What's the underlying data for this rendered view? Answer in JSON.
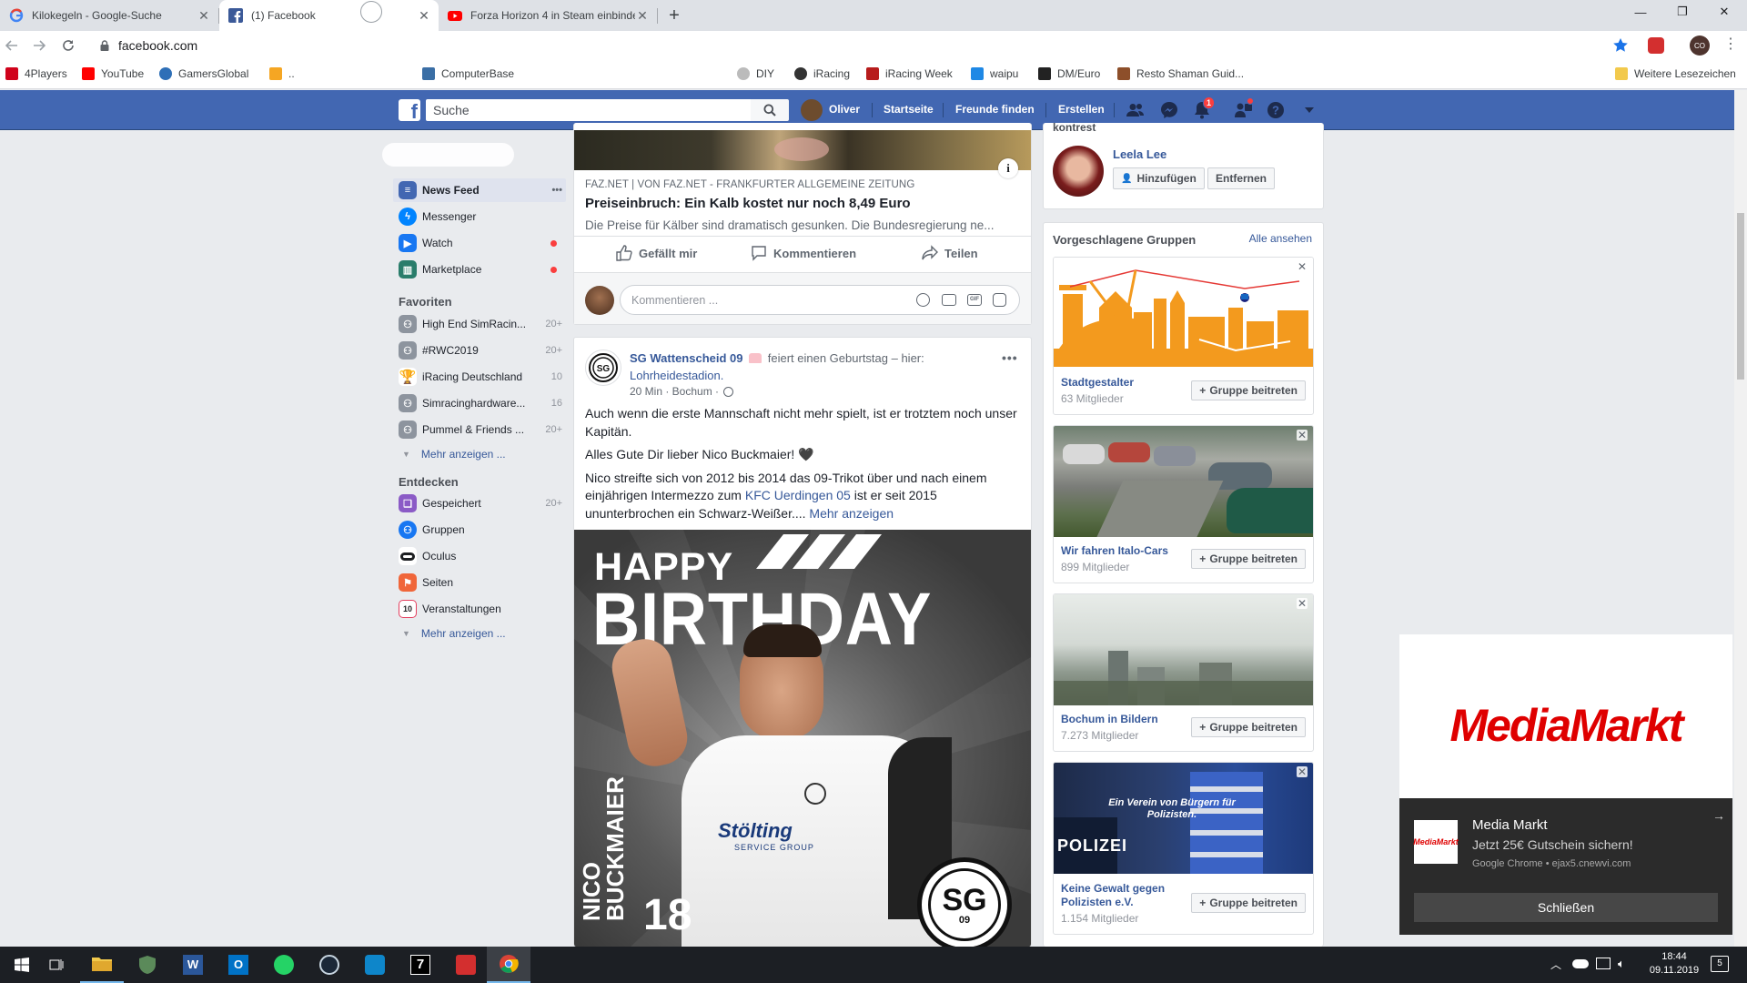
{
  "browser": {
    "tabs": [
      {
        "title": "Kilokegeln - Google-Suche",
        "icon": "google-icon"
      },
      {
        "title": "(1) Facebook",
        "icon": "facebook-icon"
      },
      {
        "title": "Forza Horizon 4 in Steam einbinde",
        "icon": "youtube-icon"
      }
    ],
    "url": "facebook.com",
    "profile_initials": "CO",
    "bookmarks": [
      {
        "label": "4Players",
        "color": "#d0021b"
      },
      {
        "label": "YouTube",
        "color": "#ff0000"
      },
      {
        "label": "GamersGlobal",
        "color": "#2e6fb7"
      },
      {
        "label": "..",
        "color": "#f5a623"
      },
      {
        "label": "ComputerBase",
        "color": "#3a6ea5"
      },
      {
        "label": "DIY",
        "color": "#bbbbbb"
      },
      {
        "label": "iRacing",
        "color": "#333333"
      },
      {
        "label": "iRacing Week",
        "color": "#b71c1c"
      },
      {
        "label": "waipu",
        "color": "#1e88e5"
      },
      {
        "label": "DM/Euro",
        "color": "#222222"
      },
      {
        "label": "Resto Shaman Guid...",
        "color": "#8d4f2a"
      },
      {
        "label": "Weitere Lesezeichen",
        "color": "#f2c94c"
      }
    ]
  },
  "fbbar": {
    "search_placeholder": "Suche",
    "user": "Oliver",
    "nav": [
      "Startseite",
      "Freunde finden",
      "Erstellen"
    ],
    "notif_count": "1"
  },
  "sidebar": {
    "main": [
      {
        "label": "News Feed",
        "icon": "news-feed-icon",
        "color": "#4267b2",
        "extra": "•••"
      },
      {
        "label": "Messenger",
        "icon": "messenger-icon",
        "color": "#0084ff",
        "extra": ""
      },
      {
        "label": "Watch",
        "icon": "watch-icon",
        "color": "#1877f2",
        "extra": "dot"
      },
      {
        "label": "Marketplace",
        "icon": "marketplace-icon",
        "color": "#2a7d6b",
        "extra": "dot"
      }
    ],
    "favorites_heading": "Favoriten",
    "favorites": [
      {
        "label": "High End SimRacin...",
        "count": "20+",
        "icon": "group-icon"
      },
      {
        "label": "#RWC2019",
        "count": "20+",
        "icon": "group-icon"
      },
      {
        "label": "iRacing Deutschland",
        "count": "10",
        "icon": "trophy-icon"
      },
      {
        "label": "Simracinghardware...",
        "count": "16",
        "icon": "group-icon"
      },
      {
        "label": "Pummel & Friends ...",
        "count": "20+",
        "icon": "group-icon"
      }
    ],
    "more_label": "Mehr anzeigen ...",
    "explore_heading": "Entdecken",
    "explore": [
      {
        "label": "Gespeichert",
        "count": "20+",
        "icon": "bookmark-icon",
        "color": "#8b5bc6"
      },
      {
        "label": "Gruppen",
        "count": "",
        "icon": "groups-icon",
        "color": "#1877f2"
      },
      {
        "label": "Oculus",
        "count": "",
        "icon": "oculus-icon",
        "color": "#1c1e21"
      },
      {
        "label": "Seiten",
        "count": "",
        "icon": "flag-icon",
        "color": "#f0663a"
      },
      {
        "label": "Veranstaltungen",
        "count": "",
        "icon": "calendar-icon",
        "color": "#e4405f"
      }
    ]
  },
  "post1": {
    "source": "FAZ.NET | VON FAZ.NET - FRANKFURTER ALLGEMEINE ZEITUNG",
    "headline": "Preiseinbruch: Ein Kalb kostet nur noch 8,49 Euro",
    "desc": "Die Preise für Kälber sind dramatisch gesunken. Die Bundesregierung ne...",
    "like": "Gefällt mir",
    "comment": "Kommentieren",
    "share": "Teilen",
    "comment_placeholder": "Kommentieren ..."
  },
  "post2": {
    "author": "SG Wattenscheid 09",
    "action": "feiert einen Geburtstag – hier:",
    "place": "Lohrheidestadion.",
    "meta": "20 Min · Bochum ·",
    "p1": "Auch wenn die erste Mannschaft nicht mehr spielt, ist er trotztem noch unser Kapitän.",
    "p2": "Alles Gute Dir lieber Nico Buckmaier! 🖤",
    "p3a": "Nico streifte sich von 2012 bis 2014 das 09-Trikot über und nach einem einjährigen Intermezzo zum",
    "p3link": "KFC Uerdingen 05",
    "p3b": "ist er seit 2015 ununterbrochen ein Schwarz-Weißer....",
    "more": "Mehr anzeigen",
    "img_happy": "HAPPY",
    "img_birthday": "BIRTHDAY",
    "img_name": "NICO BUCKMAIER",
    "img_number": "18",
    "img_sponsor": "Stölting",
    "img_sponsor_sub": "SERVICE GROUP",
    "img_badge": "SG",
    "img_badge_num": "09"
  },
  "right": {
    "cut_heading": "kontrest",
    "friend_name": "Leela Lee",
    "add_btn": "Hinzufügen",
    "remove_btn": "Entfernen",
    "groups_heading": "Vorgeschlagene Gruppen",
    "see_all": "Alle ansehen",
    "join_label": "Gruppe beitreten",
    "groups": [
      {
        "name": "Stadtgestalter",
        "members": "63 Mitglieder"
      },
      {
        "name": "Wir fahren Italo-Cars",
        "members": "899 Mitglieder"
      },
      {
        "name": "Bochum in Bildern",
        "members": "7.273 Mitglieder"
      },
      {
        "name": "Keine Gewalt gegen Polizisten e.V.",
        "members": "1.154 Mitglieder"
      }
    ],
    "police_caption": "Ein Verein von Bürgern für Polizisten.",
    "police_vest": "POLIZEI"
  },
  "ad": {
    "brand": "MediaMarkt",
    "notif_title": "Media Markt",
    "notif_text": "Jetzt 25€ Gutschein sichern!",
    "notif_src": "Google Chrome • ejax5.cnewvi.com",
    "close_btn": "Schließen"
  },
  "taskbar": {
    "time": "18:44",
    "date": "09.11.2019",
    "notif_count": "5"
  }
}
